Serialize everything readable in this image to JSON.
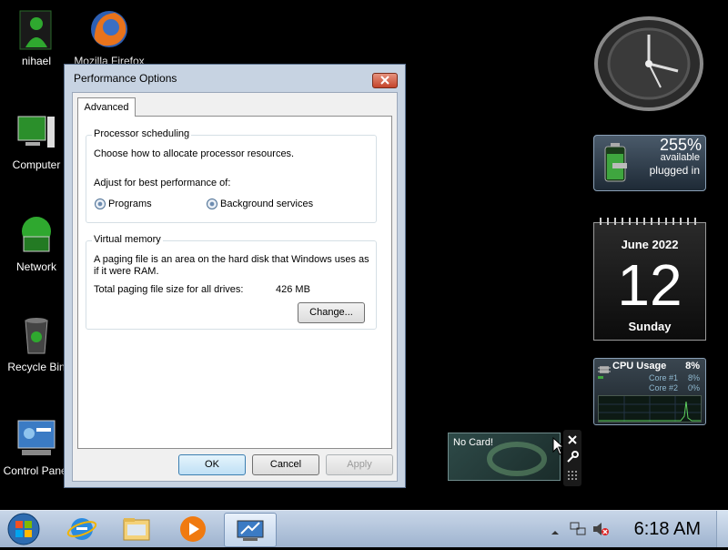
{
  "desktop": {
    "icons": [
      {
        "label": "nihael",
        "icon": "user-folder-icon"
      },
      {
        "label": "Mozilla Firefox",
        "icon": "firefox-icon"
      },
      {
        "label": "Computer",
        "icon": "computer-icon"
      },
      {
        "label": "Network",
        "icon": "network-icon"
      },
      {
        "label": "Recycle Bin",
        "icon": "recycle-bin-icon"
      },
      {
        "label": "Control Panel",
        "icon": "control-panel-icon"
      }
    ]
  },
  "dialog": {
    "title": "Performance Options",
    "tab_label": "Advanced",
    "processor": {
      "group_title": "Processor scheduling",
      "description": "Choose how to allocate processor resources.",
      "adjust_label": "Adjust for best performance of:",
      "option_programs": "Programs",
      "option_background": "Background services"
    },
    "virtual_memory": {
      "group_title": "Virtual memory",
      "description_line1": "A paging file is an area on the hard disk that Windows uses as",
      "description_line2": "if it were RAM.",
      "total_label": "Total paging file size for all drives:",
      "total_value": "426 MB",
      "change_button": "Change..."
    },
    "ok_button": "OK",
    "cancel_button": "Cancel",
    "apply_button": "Apply"
  },
  "gadgets": {
    "battery": {
      "percent": "255%",
      "status1": "available",
      "status2": "plugged in"
    },
    "calendar": {
      "month_year": "June 2022",
      "day": "12",
      "weekday": "Sunday"
    },
    "cpu": {
      "title": "CPU Usage",
      "total": "8%",
      "core1_label": "Core #1",
      "core1_value": "8%",
      "core2_label": "Core #2",
      "core2_value": "0%"
    },
    "card": {
      "text": "No Card!"
    }
  },
  "taskbar": {
    "clock": "6:18 AM"
  },
  "colors": {
    "accent": "#3c7fb1",
    "close_red": "#c4442b",
    "gadget_green": "#3fa63f"
  }
}
